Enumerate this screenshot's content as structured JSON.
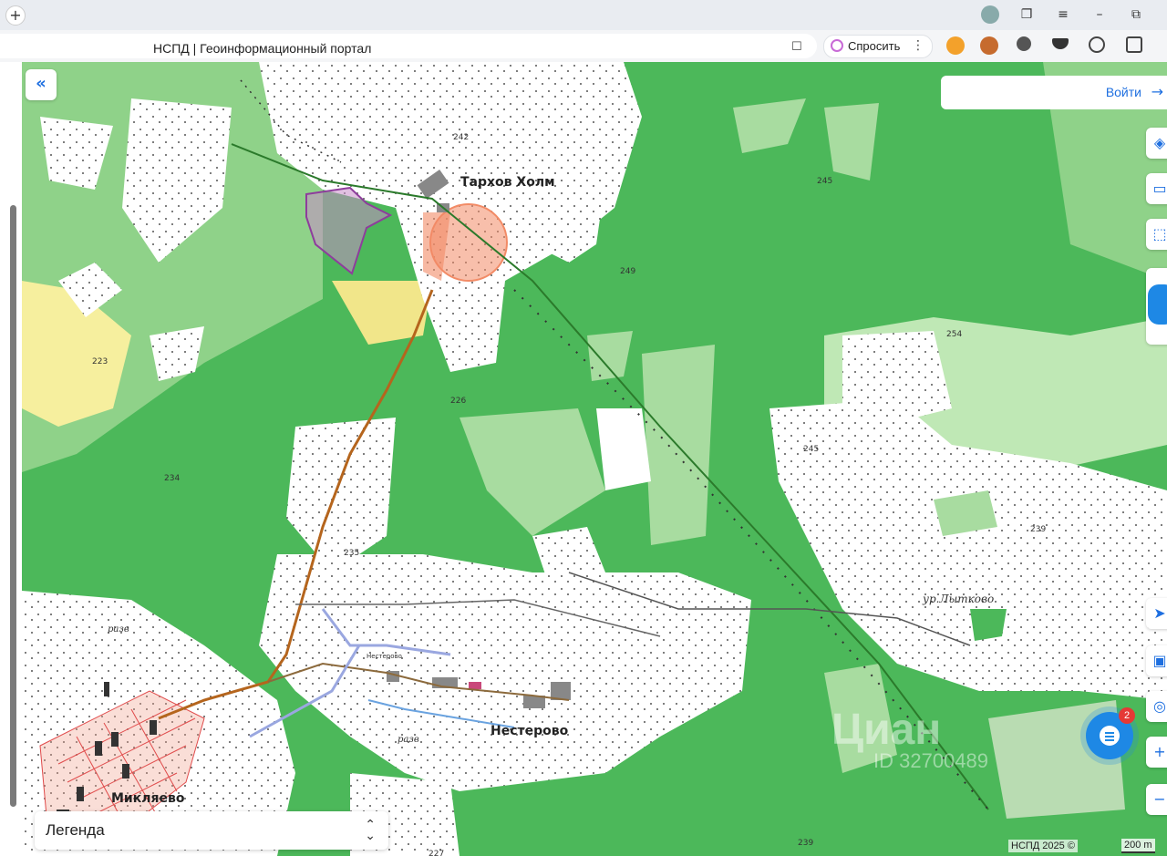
{
  "browser": {
    "page_title": "НСПД | Геоинформационный портал",
    "ask_label": "Спросить",
    "new_tab_icon": "plus-icon",
    "extension_icons": [
      "gift-extension-icon",
      "character-extension-icon",
      "planet-extension-icon",
      "helmet-extension-icon",
      "recycle-extension-icon",
      "puzzle-extension-icon"
    ]
  },
  "header": {
    "login_label": "Войти"
  },
  "map": {
    "places": [
      {
        "id": "tarkhov",
        "name": "Тархов Холм"
      },
      {
        "id": "nesterovo",
        "name": "Нестерово"
      },
      {
        "id": "miklyaevo",
        "name": "Микляево"
      },
      {
        "id": "lytkovo",
        "name": "ур.Лытково"
      }
    ],
    "elevations": [
      "242",
      "245",
      "249",
      "254",
      "223",
      "226",
      "234",
      "235",
      "245",
      "239",
      "239",
      "227"
    ],
    "small_labels": [
      "разв",
      "разв",
      "Нестерово"
    ],
    "colors": {
      "forest": "#4cb85a",
      "light_forest": "#a8dca0",
      "open": "#ffffff",
      "cadastral_outline": "#8e3d9c",
      "highlight": "#f28b66",
      "road": "#b5651d",
      "power_line": "#2b7a2b"
    }
  },
  "legend": {
    "label": "Легенда"
  },
  "footer": {
    "copyright": "НСПД 2025 ©",
    "scale": "200 m"
  },
  "chat": {
    "badge_count": "2"
  },
  "watermark": {
    "text": "Циан",
    "id": "ID 32700489"
  }
}
